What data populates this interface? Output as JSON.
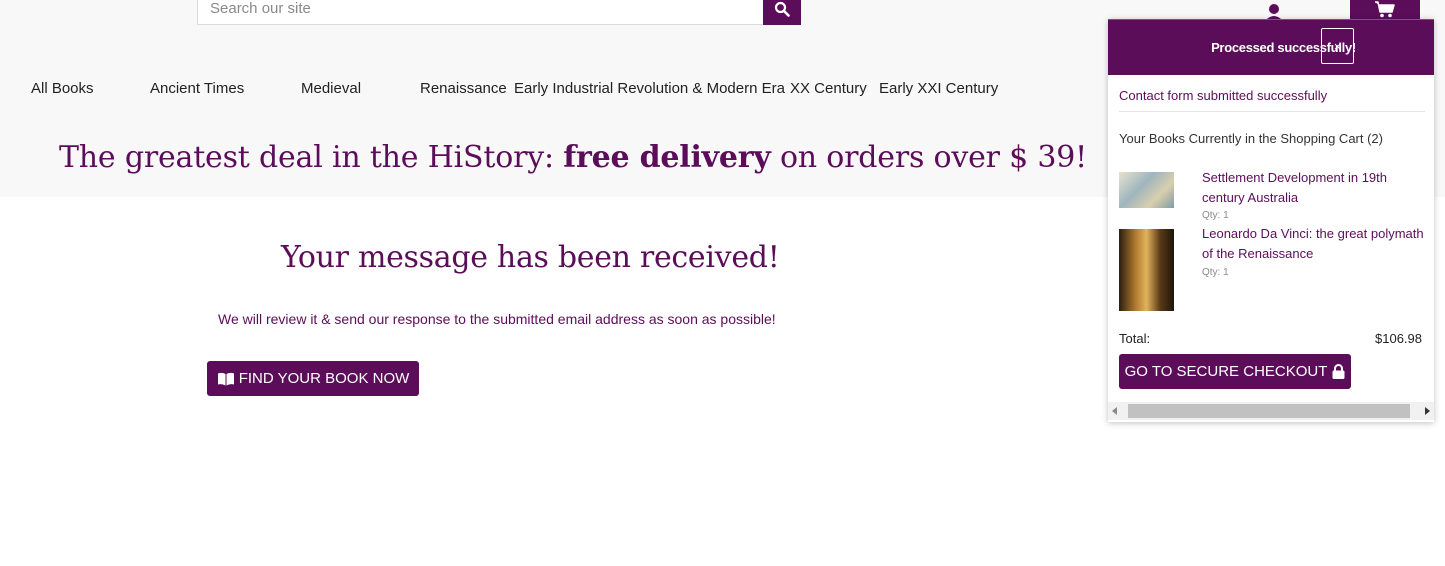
{
  "search": {
    "placeholder": "Search our site"
  },
  "icons": {
    "search": "search-icon",
    "account": "user-icon",
    "cart": "shopping-cart-icon",
    "book": "open-book-icon",
    "lock": "lock-icon",
    "close": "close-icon"
  },
  "colors": {
    "brand": "#5c0d5a",
    "header_bg": "#f8f8f8",
    "toast_border": "#1f8f3a"
  },
  "nav": {
    "items": [
      "All Books",
      "Ancient Times",
      "Medieval",
      "Renaissance",
      "Early Industrial Revolution & Modern Era",
      "XX Century",
      "Early XXI Century"
    ]
  },
  "promo": {
    "prefix": "The greatest deal in the HiStory: ",
    "highlight": "free delivery",
    "suffix": " on orders over $ 39!"
  },
  "main": {
    "title": "Your message has been received!",
    "subtitle": "We will review it & send our response to the submitted email address as soon as possible!",
    "find_button": "FIND YOUR BOOK NOW"
  },
  "toast": {
    "header": "Processed successfully!",
    "close_label": "×",
    "message": "Contact form submitted successfully",
    "cart_heading": "Your Books Currently in the Shopping Cart (2)",
    "items": [
      {
        "title": "Settlement Development in 19th century Australia",
        "qty": "Qty: 1"
      },
      {
        "title": "Leonardo Da Vinci: the great polymath of the Renaissance",
        "qty": "Qty: 1"
      }
    ],
    "total_label": "Total:",
    "total_value": "$106.98",
    "checkout_button": "GO TO SECURE CHECKOUT"
  }
}
